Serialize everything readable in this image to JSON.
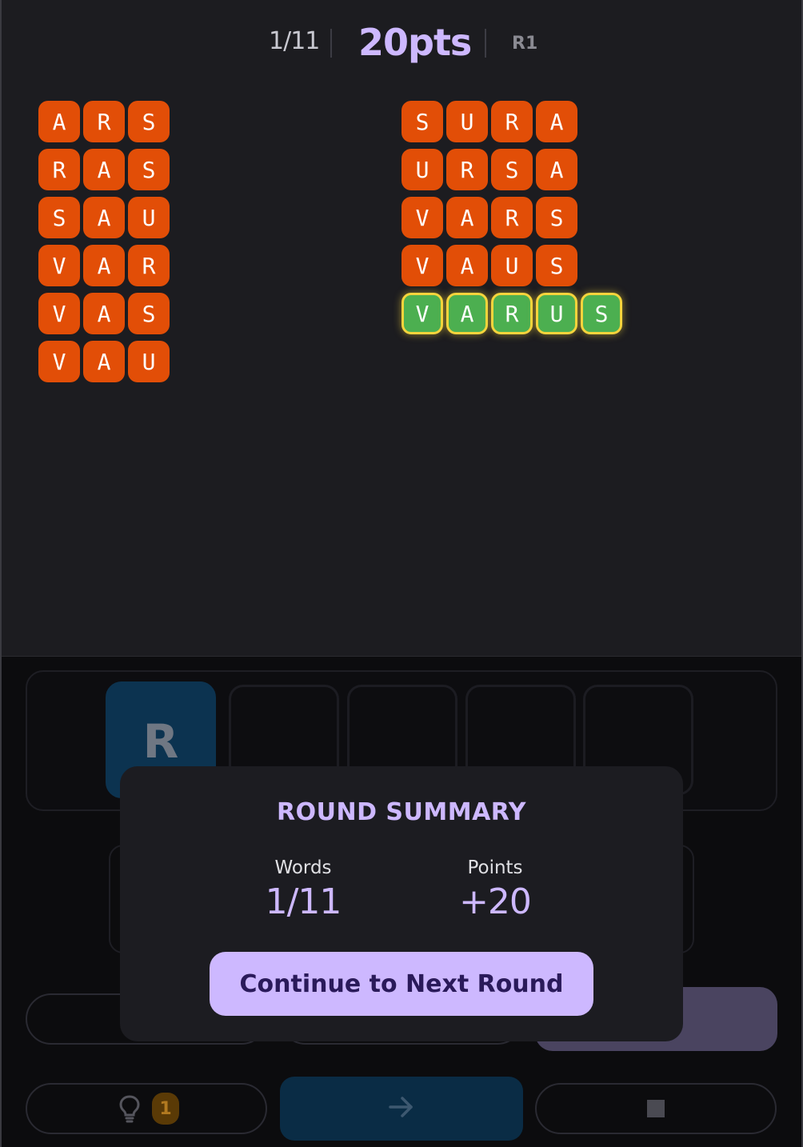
{
  "header": {
    "progress": "1/11",
    "points": "20pts",
    "round": "R1"
  },
  "words_left": [
    {
      "letters": [
        "A",
        "R",
        "S"
      ],
      "found": false
    },
    {
      "letters": [
        "R",
        "A",
        "S"
      ],
      "found": false
    },
    {
      "letters": [
        "S",
        "A",
        "U"
      ],
      "found": false
    },
    {
      "letters": [
        "V",
        "A",
        "R"
      ],
      "found": false
    },
    {
      "letters": [
        "V",
        "A",
        "S"
      ],
      "found": false
    },
    {
      "letters": [
        "V",
        "A",
        "U"
      ],
      "found": false
    }
  ],
  "words_right": [
    {
      "letters": [
        "S",
        "U",
        "R",
        "A"
      ],
      "found": false
    },
    {
      "letters": [
        "U",
        "R",
        "S",
        "A"
      ],
      "found": false
    },
    {
      "letters": [
        "V",
        "A",
        "R",
        "S"
      ],
      "found": false
    },
    {
      "letters": [
        "V",
        "A",
        "U",
        "S"
      ],
      "found": false
    },
    {
      "letters": [
        "V",
        "A",
        "R",
        "U",
        "S"
      ],
      "found": true
    }
  ],
  "input": {
    "slots": [
      "R",
      "",
      "",
      "",
      ""
    ]
  },
  "controls": {
    "hint_count": "1",
    "submit_icon": "arrow-right-icon",
    "stop_icon": "stop-icon",
    "hint_icon": "lightbulb-icon"
  },
  "modal": {
    "title": "ROUND SUMMARY",
    "words_label": "Words",
    "words_value": "1/11",
    "points_label": "Points",
    "points_value": "+20",
    "continue_label": "Continue to Next Round"
  },
  "colors": {
    "tile": "#e24e07",
    "found_tile": "#4caf50",
    "found_border": "#f5d43c",
    "accent": "#cdb8ff"
  }
}
